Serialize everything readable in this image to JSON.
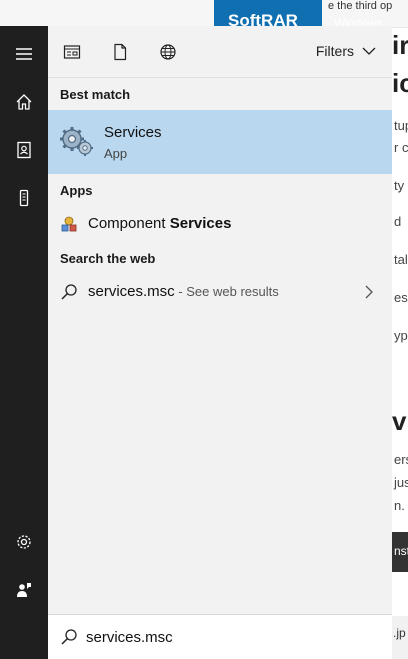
{
  "background_page": {
    "top_text": "e the third op",
    "banner_title": "SoftRAR",
    "banner_sub": "Windows",
    "headings": [
      "ir",
      "ic",
      "vi"
    ],
    "lines": [
      "tup",
      "r c",
      "ty",
      "d",
      "tal",
      "es",
      "ype",
      "ers",
      "jus",
      "n.",
      ".jp"
    ],
    "button_text": "nst"
  },
  "toolbar": {
    "icons": [
      "documents-view-icon",
      "file-icon",
      "globe-icon"
    ],
    "filters_label": "Filters"
  },
  "sections": {
    "best_match": "Best match",
    "apps": "Apps",
    "search_web": "Search the web"
  },
  "best_match": {
    "title": "Services",
    "subtitle": "App"
  },
  "apps": [
    {
      "prefix": "Component ",
      "bold": "Services"
    }
  ],
  "web": {
    "query": "services.msc",
    "suffix": " - See web results"
  },
  "search": {
    "value": "services.msc"
  },
  "rail": {
    "items": [
      "menu-icon",
      "home-icon",
      "notebook-icon",
      "device-icon",
      "settings-icon",
      "feedback-icon"
    ]
  },
  "colors": {
    "rail_bg": "#1f1f1f",
    "panel_bg": "#f2f2f2",
    "selection": "#b9d7ee",
    "banner": "#0f6fb0"
  }
}
